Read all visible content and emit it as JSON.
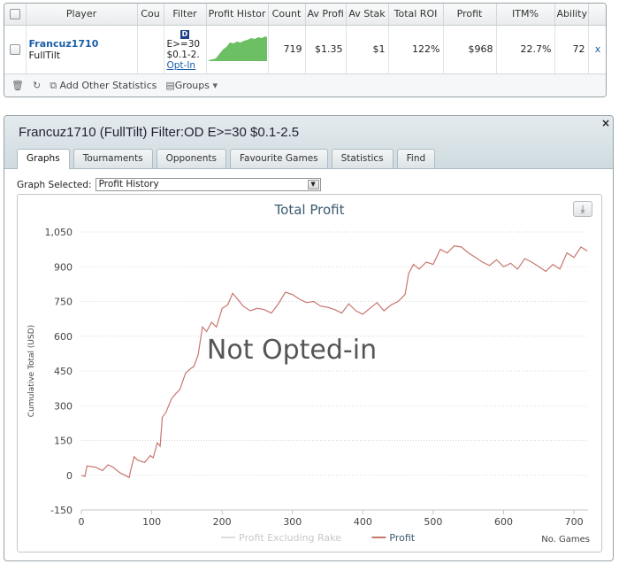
{
  "stats_table": {
    "columns": [
      "Player",
      "Cou",
      "Filter",
      "Profit Histor",
      "Count",
      "Av Profi",
      "Av Stak",
      "Total ROI",
      "Profit",
      "ITM%",
      "Ability"
    ],
    "row": {
      "player_name": "Francuz1710",
      "site": "FullTilt",
      "filter_badge": "D",
      "filter_line1": "E>=30",
      "filter_line2": "$0.1-2.",
      "filter_link": "Opt-In",
      "count": "719",
      "av_profit": "$1.35",
      "av_stake": "$1",
      "total_roi": "122%",
      "profit": "$968",
      "itm": "22.7%",
      "ability": "72",
      "remove": "x"
    },
    "footer": {
      "add_stats": "Add Other Statistics",
      "groups": "Groups"
    }
  },
  "panel": {
    "title": "Francuz1710 (FullTilt) Filter:OD E>=30 $0.1-2.5",
    "close": "×",
    "tabs": [
      "Graphs",
      "Tournaments",
      "Opponents",
      "Favourite Games",
      "Statistics",
      "Find"
    ],
    "active_tab": "Graphs",
    "graph_selected_label": "Graph Selected:",
    "graph_selected_value": "Profit History"
  },
  "chart_data": {
    "type": "line",
    "title": "Total Profit",
    "ylabel": "Cumulative Total (USD)",
    "xlabel": "No. Games",
    "overlay_text": "Not Opted-in",
    "xlim": [
      0,
      720
    ],
    "ylim": [
      -150,
      1050
    ],
    "x_ticks": [
      0,
      100,
      200,
      300,
      400,
      500,
      600,
      700
    ],
    "y_ticks": [
      -150,
      0,
      150,
      300,
      450,
      600,
      750,
      900,
      1050
    ],
    "legend": [
      {
        "name": "Profit Excluding Rake",
        "color": "#dddddd"
      },
      {
        "name": "Profit",
        "color": "#c8776f"
      }
    ],
    "series": [
      {
        "name": "Profit",
        "color": "#c8776f",
        "x": [
          0,
          5,
          8,
          20,
          30,
          38,
          45,
          55,
          62,
          68,
          70,
          75,
          80,
          90,
          98,
          102,
          108,
          112,
          115,
          120,
          128,
          135,
          140,
          148,
          155,
          160,
          166,
          172,
          178,
          185,
          192,
          200,
          208,
          215,
          222,
          230,
          240,
          250,
          260,
          270,
          280,
          290,
          300,
          310,
          320,
          330,
          340,
          350,
          360,
          370,
          380,
          390,
          400,
          410,
          420,
          430,
          440,
          450,
          460,
          465,
          472,
          480,
          490,
          500,
          510,
          520,
          530,
          540,
          550,
          560,
          570,
          580,
          590,
          600,
          610,
          620,
          630,
          640,
          650,
          660,
          670,
          680,
          690,
          700,
          710,
          719
        ],
        "y": [
          0,
          -5,
          40,
          35,
          20,
          45,
          35,
          10,
          0,
          -10,
          20,
          80,
          65,
          55,
          85,
          75,
          140,
          125,
          250,
          270,
          330,
          355,
          370,
          440,
          460,
          470,
          520,
          640,
          620,
          660,
          640,
          720,
          735,
          785,
          760,
          730,
          710,
          720,
          715,
          700,
          740,
          790,
          780,
          760,
          745,
          750,
          730,
          725,
          715,
          700,
          740,
          710,
          695,
          720,
          745,
          710,
          735,
          750,
          780,
          870,
          910,
          890,
          920,
          910,
          975,
          960,
          990,
          985,
          960,
          940,
          920,
          905,
          930,
          900,
          915,
          890,
          935,
          920,
          900,
          880,
          910,
          890,
          960,
          940,
          985,
          968
        ]
      }
    ]
  }
}
